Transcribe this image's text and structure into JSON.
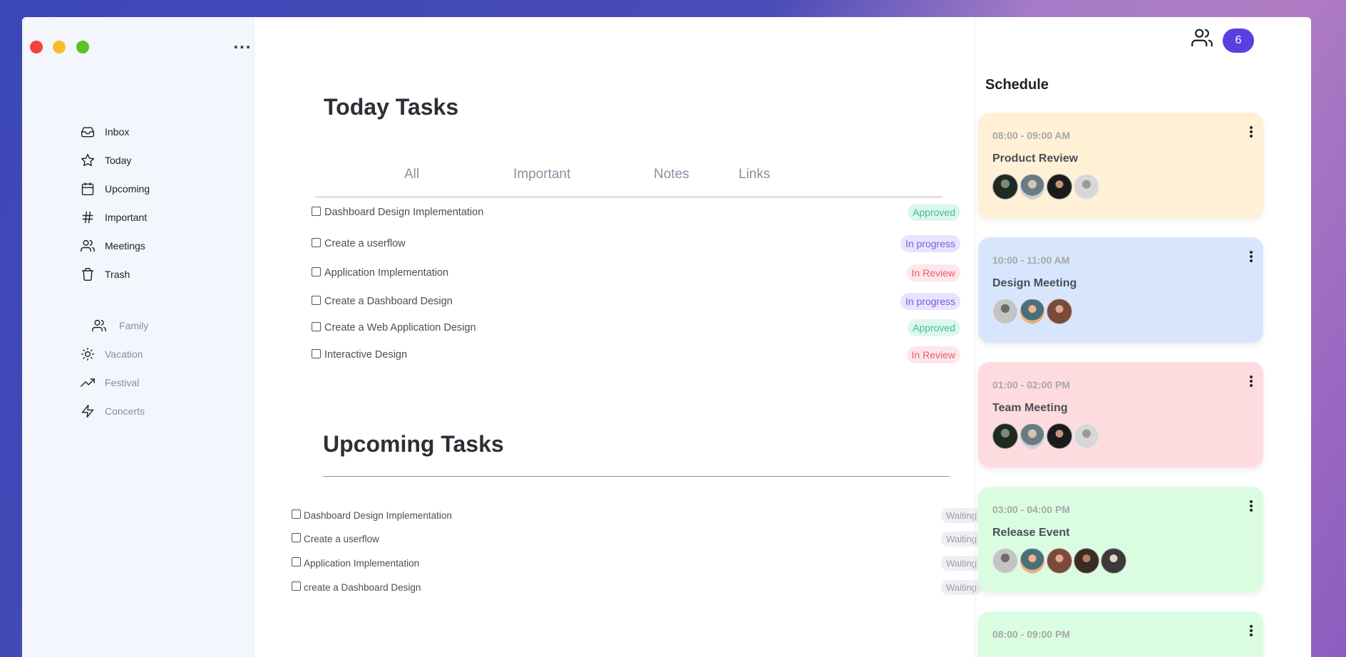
{
  "sidebar": {
    "nav": [
      {
        "label": "Inbox",
        "icon": "inbox-icon"
      },
      {
        "label": "Today",
        "icon": "star-icon"
      },
      {
        "label": "Upcoming",
        "icon": "calendar-icon"
      },
      {
        "label": "Important",
        "icon": "hash-icon"
      },
      {
        "label": "Meetings",
        "icon": "users-icon"
      },
      {
        "label": "Trash",
        "icon": "trash-icon"
      }
    ],
    "lists": [
      {
        "label": "Family",
        "icon": "users-icon"
      },
      {
        "label": "Vacation",
        "icon": "sun-icon"
      },
      {
        "label": "Festival",
        "icon": "trending-up-icon"
      },
      {
        "label": "Concerts",
        "icon": "zap-icon"
      }
    ]
  },
  "today": {
    "title": "Today Tasks",
    "tabs": [
      "All",
      "Important",
      "Notes",
      "Links"
    ],
    "tasks": [
      {
        "label": "Dashboard Design Implementation",
        "status": "Approved"
      },
      {
        "label": "Create a userflow",
        "status": "In progress"
      },
      {
        "label": "Application Implementation",
        "status": "In Review"
      },
      {
        "label": "Create a Dashboard Design",
        "status": "In progress"
      },
      {
        "label": "Create a Web Application Design",
        "status": "Approved"
      },
      {
        "label": "Interactive Design",
        "status": "In Review"
      }
    ]
  },
  "upcoming": {
    "title": "Upcoming Tasks",
    "tasks": [
      {
        "label": "Dashboard Design Implementation",
        "status": "Waiting"
      },
      {
        "label": "Create a userflow",
        "status": "Waiting"
      },
      {
        "label": "Application Implementation",
        "status": "Waiting"
      },
      {
        "label": "create a Dashboard Design",
        "status": "Waiting"
      }
    ]
  },
  "header": {
    "notification_count": "6"
  },
  "schedule": {
    "title": "Schedule",
    "events": [
      {
        "time": "08:00 - 09:00 AM",
        "title": "Product Review",
        "color": "#fff0d6"
      },
      {
        "time": "10:00 - 11:00 AM",
        "title": "Design Meeting",
        "color": "#d8e6fd"
      },
      {
        "time": "01:00 - 02:00 PM",
        "title": "Team Meeting",
        "color": "#fddbde"
      },
      {
        "time": "03:00 - 04:00 PM",
        "title": "Release Event",
        "color": "#dafde2"
      },
      {
        "time": "08:00 - 09:00 PM",
        "title": "",
        "color": "#dafde2"
      }
    ]
  }
}
